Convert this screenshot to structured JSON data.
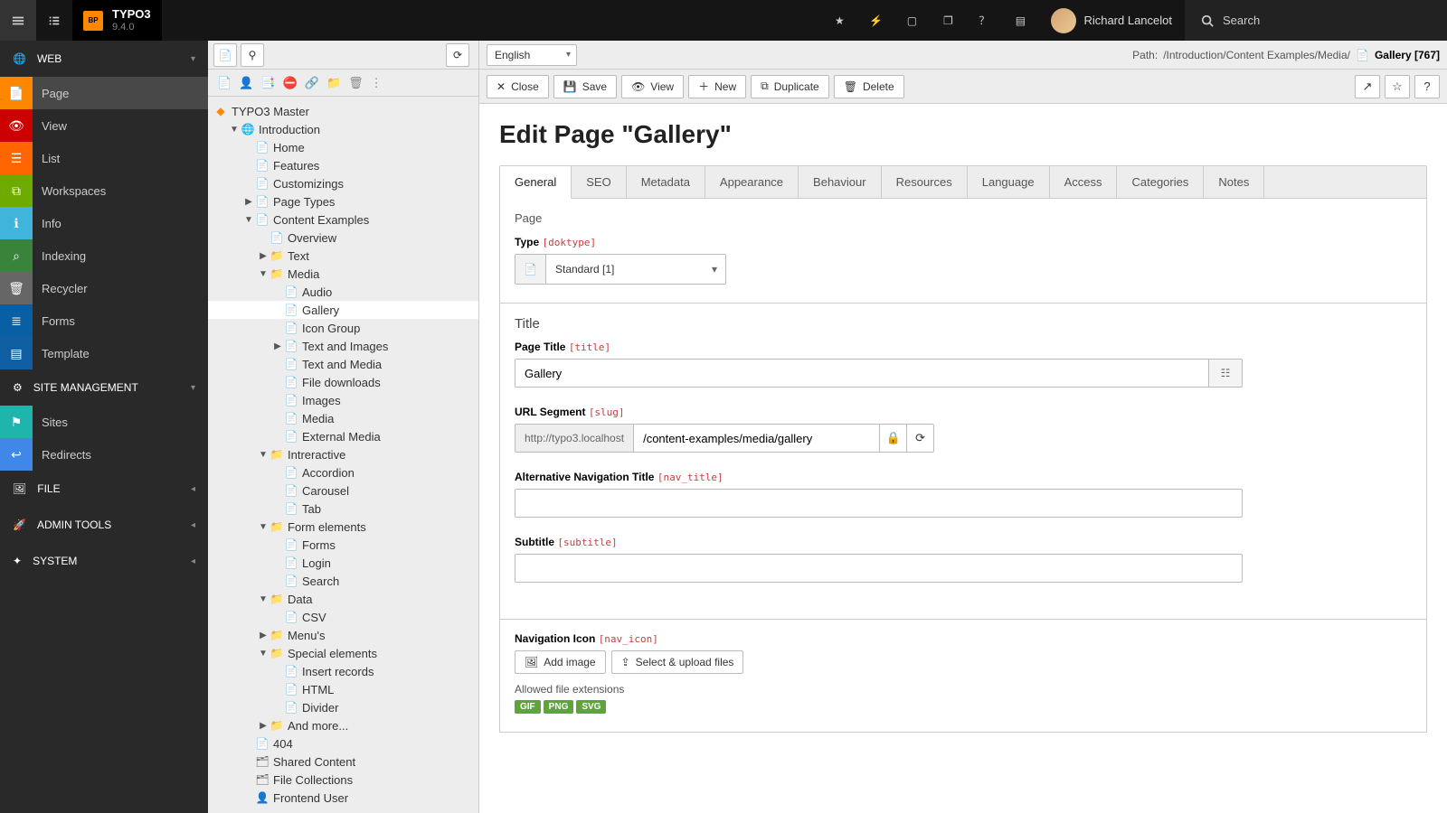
{
  "brand": {
    "name": "TYPO3",
    "version": "9.4.0",
    "logo_text": "BP"
  },
  "topbar": {
    "user_name": "Richard Lancelot",
    "search_placeholder": "Search"
  },
  "module_menu": {
    "groups": [
      {
        "label": "WEB",
        "items": [
          {
            "id": "page",
            "label": "Page",
            "colorClass": "mc-page",
            "glyph": "📄",
            "active": true
          },
          {
            "id": "view",
            "label": "View",
            "colorClass": "mc-view",
            "glyph": "👁"
          },
          {
            "id": "list",
            "label": "List",
            "colorClass": "mc-list",
            "glyph": "☰"
          },
          {
            "id": "workspaces",
            "label": "Workspaces",
            "colorClass": "mc-ws",
            "glyph": "⧉"
          },
          {
            "id": "info",
            "label": "Info",
            "colorClass": "mc-info",
            "glyph": "ℹ"
          },
          {
            "id": "indexing",
            "label": "Indexing",
            "colorClass": "mc-index",
            "glyph": "⌕"
          },
          {
            "id": "recycler",
            "label": "Recycler",
            "colorClass": "mc-rec",
            "glyph": "🗑"
          },
          {
            "id": "forms",
            "label": "Forms",
            "colorClass": "mc-forms",
            "glyph": "≣"
          },
          {
            "id": "template",
            "label": "Template",
            "colorClass": "mc-tmpl",
            "glyph": "▤"
          }
        ]
      },
      {
        "label": "SITE MANAGEMENT",
        "items": [
          {
            "id": "sites",
            "label": "Sites",
            "colorClass": "mc-sites",
            "glyph": "⚑"
          },
          {
            "id": "redirects",
            "label": "Redirects",
            "colorClass": "mc-red",
            "glyph": "↩"
          }
        ]
      },
      {
        "label": "FILE",
        "collapsed": true,
        "items": []
      },
      {
        "label": "ADMIN TOOLS",
        "collapsed": true,
        "items": []
      },
      {
        "label": "SYSTEM",
        "collapsed": true,
        "items": []
      }
    ],
    "group_icons": {
      "WEB": "🌐",
      "SITE MANAGEMENT": "⚙",
      "FILE": "🖼",
      "ADMIN TOOLS": "🚀",
      "SYSTEM": "✦"
    }
  },
  "page_tree": {
    "root": "TYPO3 Master",
    "nodes": [
      {
        "d": 0,
        "t": "▼",
        "icon": "🌐",
        "label": "Introduction"
      },
      {
        "d": 1,
        "t": "",
        "icon": "📄",
        "label": "Home"
      },
      {
        "d": 1,
        "t": "",
        "icon": "📄",
        "label": "Features"
      },
      {
        "d": 1,
        "t": "",
        "icon": "📄",
        "label": "Customizings"
      },
      {
        "d": 1,
        "t": "▶",
        "icon": "📄",
        "label": "Page Types"
      },
      {
        "d": 1,
        "t": "▼",
        "icon": "📄",
        "label": "Content Examples"
      },
      {
        "d": 2,
        "t": "",
        "icon": "📄",
        "label": "Overview"
      },
      {
        "d": 2,
        "t": "▶",
        "icon": "📁",
        "label": "Text"
      },
      {
        "d": 2,
        "t": "▼",
        "icon": "📁",
        "label": "Media"
      },
      {
        "d": 3,
        "t": "",
        "icon": "📄",
        "label": "Audio"
      },
      {
        "d": 3,
        "t": "",
        "icon": "📄",
        "label": "Gallery",
        "selected": true
      },
      {
        "d": 3,
        "t": "",
        "icon": "📄",
        "label": "Icon Group"
      },
      {
        "d": 3,
        "t": "▶",
        "icon": "📄",
        "label": "Text and Images"
      },
      {
        "d": 3,
        "t": "",
        "icon": "📄",
        "label": "Text and Media"
      },
      {
        "d": 3,
        "t": "",
        "icon": "📄",
        "label": "File downloads"
      },
      {
        "d": 3,
        "t": "",
        "icon": "📄",
        "label": "Images"
      },
      {
        "d": 3,
        "t": "",
        "icon": "📄",
        "label": "Media"
      },
      {
        "d": 3,
        "t": "",
        "icon": "📄",
        "label": "External Media"
      },
      {
        "d": 2,
        "t": "▼",
        "icon": "📁",
        "label": "Intreractive"
      },
      {
        "d": 3,
        "t": "",
        "icon": "📄",
        "label": "Accordion"
      },
      {
        "d": 3,
        "t": "",
        "icon": "📄",
        "label": "Carousel"
      },
      {
        "d": 3,
        "t": "",
        "icon": "📄",
        "label": "Tab"
      },
      {
        "d": 2,
        "t": "▼",
        "icon": "📁",
        "label": "Form elements"
      },
      {
        "d": 3,
        "t": "",
        "icon": "📄",
        "label": "Forms"
      },
      {
        "d": 3,
        "t": "",
        "icon": "📄",
        "label": "Login"
      },
      {
        "d": 3,
        "t": "",
        "icon": "📄",
        "label": "Search"
      },
      {
        "d": 2,
        "t": "▼",
        "icon": "📁",
        "label": "Data"
      },
      {
        "d": 3,
        "t": "",
        "icon": "📄",
        "label": "CSV"
      },
      {
        "d": 2,
        "t": "▶",
        "icon": "📁",
        "label": "Menu's"
      },
      {
        "d": 2,
        "t": "▼",
        "icon": "📁",
        "label": "Special elements"
      },
      {
        "d": 3,
        "t": "",
        "icon": "📄",
        "label": "Insert records"
      },
      {
        "d": 3,
        "t": "",
        "icon": "📄",
        "label": "HTML"
      },
      {
        "d": 3,
        "t": "",
        "icon": "📄",
        "label": "Divider"
      },
      {
        "d": 2,
        "t": "▶",
        "icon": "📁",
        "label": "And more..."
      },
      {
        "d": 1,
        "t": "",
        "icon": "📄",
        "label": "404"
      },
      {
        "d": 1,
        "t": "",
        "icon": "🗂",
        "label": "Shared Content"
      },
      {
        "d": 1,
        "t": "",
        "icon": "🗂",
        "label": "File Collections"
      },
      {
        "d": 1,
        "t": "",
        "icon": "👤",
        "label": "Frontend User"
      }
    ]
  },
  "doc_header": {
    "language": "English",
    "path_prefix": "Path: ",
    "path": "/Introduction/Content Examples/Media/",
    "page_name": "Gallery",
    "page_uid": "[767]"
  },
  "actions": {
    "close": "Close",
    "save": "Save",
    "view": "View",
    "new": "New",
    "duplicate": "Duplicate",
    "delete": "Delete"
  },
  "content": {
    "heading": "Edit Page \"Gallery\"",
    "tabs": [
      "General",
      "SEO",
      "Metadata",
      "Appearance",
      "Behaviour",
      "Resources",
      "Language",
      "Access",
      "Categories",
      "Notes"
    ],
    "active_tab": 0,
    "section_page": "Page",
    "type_label": "Type",
    "type_tech": "[doktype]",
    "type_value": "Standard [1]",
    "section_title": "Title",
    "page_title_label": "Page Title",
    "page_title_tech": "[title]",
    "page_title_value": "Gallery",
    "url_segment_label": "URL Segment",
    "url_segment_tech": "[slug]",
    "url_base": "http://typo3.localhost",
    "url_segment_value": "/content-examples/media/gallery",
    "nav_title_label": "Alternative Navigation Title",
    "nav_title_tech": "[nav_title]",
    "nav_title_value": "",
    "subtitle_label": "Subtitle",
    "subtitle_tech": "[subtitle]",
    "subtitle_value": "",
    "nav_icon_label": "Navigation Icon",
    "nav_icon_tech": "[nav_icon]",
    "add_image": "Add image",
    "select_upload": "Select & upload files",
    "allowed_ext_label": "Allowed file extensions",
    "allowed_ext": [
      "GIF",
      "PNG",
      "SVG"
    ]
  }
}
